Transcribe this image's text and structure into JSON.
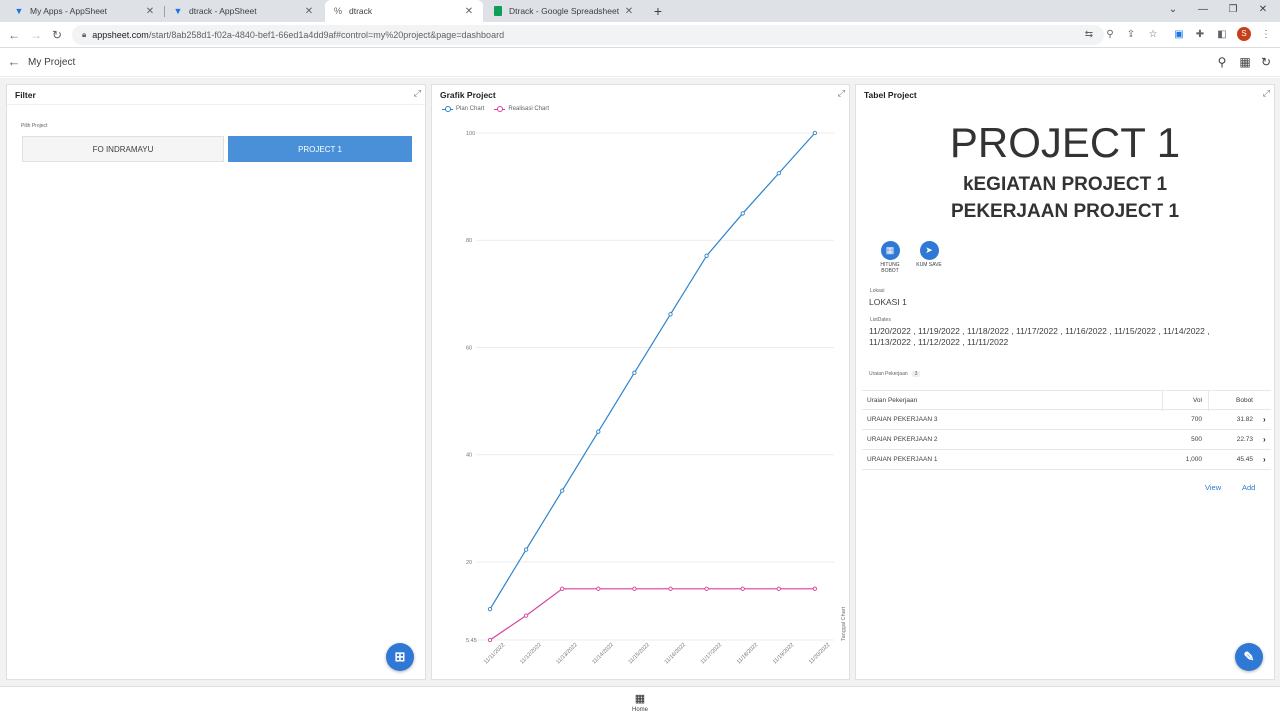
{
  "browser": {
    "tabs": [
      {
        "title": "My Apps - AppSheet",
        "icon": "appsheet-icon"
      },
      {
        "title": "dtrack - AppSheet",
        "icon": "appsheet-icon"
      },
      {
        "title": "dtrack",
        "icon": "link-icon"
      },
      {
        "title": "Dtrack - Google Spreadsheet",
        "icon": "sheets-icon"
      }
    ],
    "url_host": "appsheet.com",
    "url_path": "/start/8ab258d1-f02a-4840-bef1-66ed1a4dd9af#control=my%20project&page=dashboard",
    "profile_initial": "S"
  },
  "app": {
    "title": "My Project",
    "home_label": "Home"
  },
  "filter": {
    "title": "Filter",
    "field_label": "Pilih Project",
    "options": [
      "FO INDRAMAYU",
      "PROJECT 1"
    ],
    "selected": "PROJECT 1"
  },
  "grafik": {
    "title": "Grafik Project",
    "legend": [
      "Plan Chart",
      "Realisasi Chart"
    ],
    "side_label": "Tanggal Chart"
  },
  "chart_data": {
    "type": "line",
    "categories": [
      "11/11/2022",
      "11/12/2022",
      "11/13/2022",
      "11/14/2022",
      "11/15/2022",
      "11/16/2022",
      "11/17/2022",
      "11/18/2022",
      "11/19/2022",
      "11/20/2022"
    ],
    "series": [
      {
        "name": "Plan Chart",
        "color": "#2f83cb",
        "values": [
          11.2,
          22.3,
          33.3,
          44.3,
          55.3,
          66.2,
          77.1,
          85.0,
          92.5,
          100
        ]
      },
      {
        "name": "Realisasi Chart",
        "color": "#d6409f",
        "values": [
          5.45,
          10.0,
          15.0,
          15.0,
          15.0,
          15.0,
          15.0,
          15.0,
          15.0,
          15.0
        ]
      }
    ],
    "ylim": [
      5.45,
      100
    ],
    "yticks": [
      "5.45",
      "20",
      "40",
      "60",
      "80",
      "100"
    ],
    "grid": true,
    "legend_position": "top-left"
  },
  "tabel": {
    "title": "Tabel Project",
    "project": "PROJECT 1",
    "kegiatan": "kEGIATAN PROJECT 1",
    "pekerjaan": "PEKERJAAN PROJECT 1",
    "actions": [
      {
        "label": "HITUNG BOBOT",
        "icon": "calculator-icon"
      },
      {
        "label": "KUM SAVE",
        "icon": "send-icon"
      }
    ],
    "lokasi_label": "Lokasi",
    "lokasi_value": "LOKASI 1",
    "listdates_label": "ListDates",
    "listdates_line1": "11/20/2022 , 11/19/2022 , 11/18/2022 , 11/17/2022 , 11/16/2022 , 11/15/2022 , 11/14/2022 ,",
    "listdates_line2": "11/13/2022 , 11/12/2022 , 11/11/2022",
    "uraian_label": "Uraian Pekerjaan",
    "uraian_count": "3",
    "columns": [
      "Uraian Pekerjaan",
      "Vol",
      "Bobot"
    ],
    "rows": [
      {
        "name": "URAIAN PEKERJAAN 3",
        "vol": "700",
        "bobot": "31.82"
      },
      {
        "name": "URAIAN PEKERJAAN 2",
        "vol": "500",
        "bobot": "22.73"
      },
      {
        "name": "URAIAN PEKERJAAN 1",
        "vol": "1,000",
        "bobot": "45.45"
      }
    ],
    "view_label": "View",
    "add_label": "Add"
  }
}
